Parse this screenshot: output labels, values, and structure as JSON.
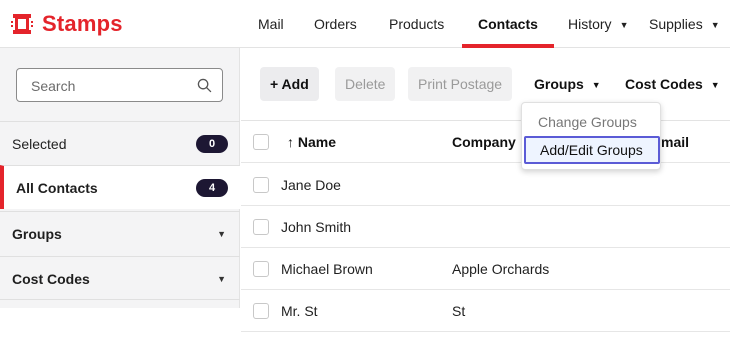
{
  "app": {
    "name": "Stamps",
    "brand_color": "#e4242b"
  },
  "nav": {
    "items": [
      {
        "label": "Mail"
      },
      {
        "label": "Orders"
      },
      {
        "label": "Products"
      },
      {
        "label": "Contacts",
        "active": true
      },
      {
        "label": "History",
        "has_dropdown": true
      },
      {
        "label": "Supplies",
        "has_dropdown": true
      }
    ]
  },
  "sidebar": {
    "search_placeholder": "Search",
    "items": [
      {
        "label": "Selected",
        "count": "0"
      },
      {
        "label": "All Contacts",
        "count": "4",
        "active": true
      },
      {
        "label": "Groups",
        "has_dropdown": true
      },
      {
        "label": "Cost Codes",
        "has_dropdown": true
      }
    ]
  },
  "toolbar": {
    "add_label": "+ Add",
    "delete_label": "Delete",
    "print_label": "Print Postage",
    "groups_label": "Groups",
    "cost_codes_label": "Cost Codes"
  },
  "groups_menu": {
    "items": [
      "Change Groups",
      "Add/Edit Groups"
    ],
    "focused_index": 1
  },
  "table": {
    "columns": {
      "name": "↑ Name",
      "company": "Company",
      "email": "mail"
    },
    "rows": [
      {
        "name": "Jane Doe",
        "company": ""
      },
      {
        "name": "John Smith",
        "company": ""
      },
      {
        "name": "Michael Brown",
        "company": "Apple Orchards"
      },
      {
        "name": "Mr. St",
        "company": "St"
      }
    ]
  }
}
